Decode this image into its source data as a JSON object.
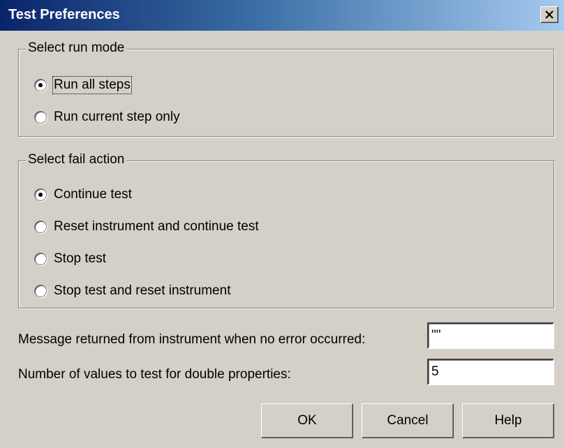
{
  "window": {
    "title": "Test Preferences",
    "close_glyph": "close-icon"
  },
  "run_mode": {
    "legend": "Select run mode",
    "options": [
      "Run all steps",
      "Run current step only"
    ],
    "selected": "Run all steps"
  },
  "fail_action": {
    "legend": "Select fail action",
    "options": [
      "Continue test",
      "Reset instrument and continue test",
      "Stop test",
      "Stop test and reset instrument"
    ],
    "selected": "Continue test"
  },
  "fields": {
    "no_error_message_label": "Message returned from instrument when no error occurred:",
    "no_error_message_value": "\"\"",
    "double_values_label": "Number of values to test for double properties:",
    "double_values_value": "5"
  },
  "buttons": {
    "ok": "OK",
    "cancel": "Cancel",
    "help": "Help"
  }
}
